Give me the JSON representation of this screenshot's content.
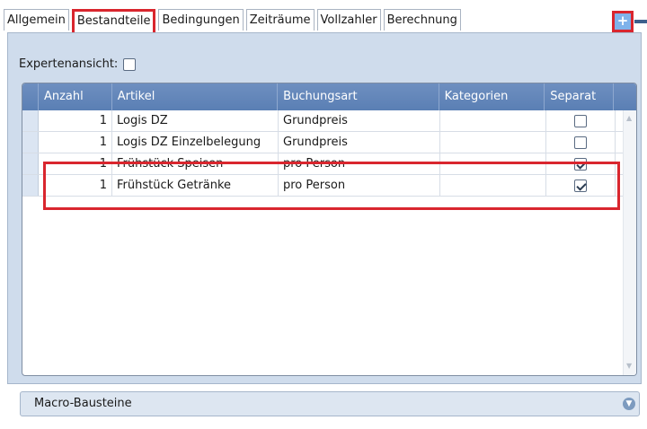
{
  "tabs": [
    {
      "label": "Allgemein"
    },
    {
      "label": "Bestandteile"
    },
    {
      "label": "Bedingungen"
    },
    {
      "label": "Zeiträume"
    },
    {
      "label": "Vollzahler"
    },
    {
      "label": "Berechnung"
    }
  ],
  "active_tab": "Bestandteile",
  "toolbar": {
    "add_label": "+"
  },
  "expert": {
    "label": "Expertenansicht:",
    "checked": false
  },
  "grid": {
    "columns": [
      "Anzahl",
      "Artikel",
      "Buchungsart",
      "Kategorien",
      "Separat"
    ],
    "rows": [
      {
        "anzahl": "1",
        "artikel": "Logis DZ",
        "buchungsart": "Grundpreis",
        "kategorien": "",
        "separat": false
      },
      {
        "anzahl": "1",
        "artikel": "Logis DZ Einzelbelegung",
        "buchungsart": "Grundpreis",
        "kategorien": "",
        "separat": false
      },
      {
        "anzahl": "1",
        "artikel": "Frühstück Speisen",
        "buchungsart": "pro Person",
        "kategorien": "",
        "separat": true
      },
      {
        "anzahl": "1",
        "artikel": "Frühstück Getränke",
        "buchungsart": "pro Person",
        "kategorien": "",
        "separat": true
      }
    ]
  },
  "macro": {
    "label": "Macro-Bausteine"
  },
  "colors": {
    "accent_highlight": "#d9262e",
    "header_blue": "#5a7fb4",
    "panel_bg": "#cfdcec"
  }
}
